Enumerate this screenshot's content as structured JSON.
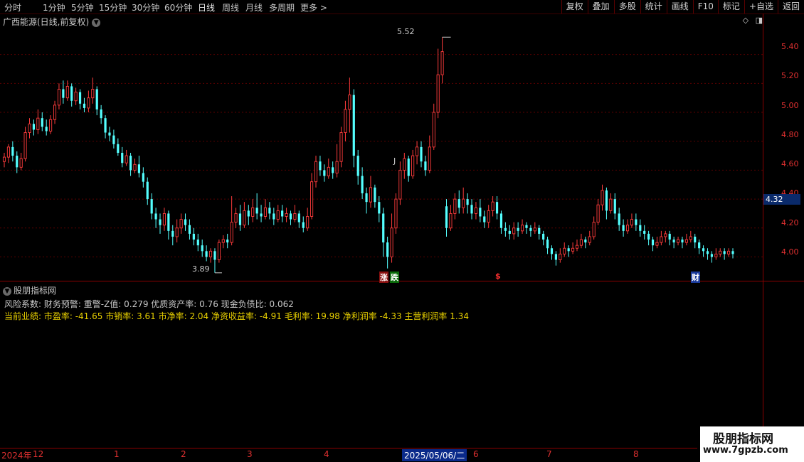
{
  "toolbar": {
    "timeframes": [
      "分时",
      "1分钟",
      "5分钟",
      "15分钟",
      "30分钟",
      "60分钟",
      "日线",
      "周线",
      "月线",
      "多周期",
      "更多 >"
    ],
    "right_buttons": [
      "复权",
      "叠加",
      "多股",
      "统计",
      "画线",
      "F10",
      "标记",
      "+自选",
      "返回"
    ]
  },
  "chart": {
    "title": "广西能源(日线,前复权)",
    "y_ticks": [
      "5.40",
      "5.20",
      "5.00",
      "4.80",
      "4.60",
      "4.40",
      "4.20",
      "4.00"
    ],
    "current_price": "4.32",
    "high_label": "5.52",
    "low_label": "3.89",
    "j_label": "J",
    "markers": {
      "zhang": "涨",
      "die": "跌",
      "dollar": "$",
      "cai": "财"
    }
  },
  "indicator": {
    "title": "股朋指标网",
    "line1": "风险系数: 财务预警: 重警-Z值: 0.279 优质资产率: 0.76 现金负债比: 0.062",
    "line2": "当前业绩: 市盈率: -41.65 市销率: 3.61 市净率: 2.04 净资收益率: -4.91 毛利率: 19.98 净利润率 -4.33 主营利润率 1.34"
  },
  "x_axis": {
    "labels": [
      "2024年",
      "12",
      "1",
      "2",
      "3",
      "4",
      "2025/05/06/二",
      "6",
      "7",
      "8"
    ]
  },
  "watermark": {
    "name": "股朋指标网",
    "url": "www.7gpzb.com"
  },
  "colors": {
    "up": "#ff3c3c",
    "down": "#54ffff",
    "axis": "#8a0000",
    "grid": "#5a0000",
    "info": "#e8d000"
  },
  "chart_data": {
    "type": "candlestick",
    "y_range": [
      3.84,
      5.6
    ],
    "candles": [
      [
        4.66,
        4.69,
        4.62,
        4.72
      ],
      [
        4.69,
        4.76,
        4.65,
        4.78
      ],
      [
        4.76,
        4.7,
        4.66,
        4.8
      ],
      [
        4.7,
        4.62,
        4.58,
        4.73
      ],
      [
        4.62,
        4.68,
        4.6,
        4.72
      ],
      [
        4.68,
        4.86,
        4.66,
        4.9
      ],
      [
        4.86,
        4.92,
        4.82,
        4.96
      ],
      [
        4.92,
        4.88,
        4.84,
        4.95
      ],
      [
        4.88,
        4.96,
        4.85,
        5.02
      ],
      [
        4.96,
        4.9,
        4.87,
        5.0
      ],
      [
        4.9,
        4.87,
        4.84,
        4.95
      ],
      [
        4.87,
        4.95,
        4.85,
        4.98
      ],
      [
        4.95,
        5.05,
        4.92,
        5.08
      ],
      [
        5.05,
        5.16,
        5.02,
        5.2
      ],
      [
        5.16,
        5.1,
        5.06,
        5.22
      ],
      [
        5.1,
        5.18,
        5.08,
        5.22
      ],
      [
        5.18,
        5.08,
        5.04,
        5.2
      ],
      [
        5.08,
        5.14,
        5.05,
        5.17
      ],
      [
        5.14,
        5.06,
        5.02,
        5.16
      ],
      [
        5.06,
        5.03,
        5.0,
        5.1
      ],
      [
        5.03,
        5.1,
        5.0,
        5.15
      ],
      [
        5.1,
        5.16,
        5.06,
        5.24
      ],
      [
        5.16,
        5.02,
        4.98,
        5.18
      ],
      [
        5.02,
        4.96,
        4.92,
        5.05
      ],
      [
        4.96,
        4.86,
        4.82,
        4.98
      ],
      [
        4.86,
        4.84,
        4.8,
        4.9
      ],
      [
        4.84,
        4.78,
        4.75,
        4.88
      ],
      [
        4.78,
        4.72,
        4.7,
        4.82
      ],
      [
        4.72,
        4.65,
        4.62,
        4.76
      ],
      [
        4.65,
        4.7,
        4.63,
        4.74
      ],
      [
        4.7,
        4.6,
        4.56,
        4.72
      ],
      [
        4.6,
        4.64,
        4.58,
        4.68
      ],
      [
        4.64,
        4.58,
        4.55,
        4.7
      ],
      [
        4.58,
        4.52,
        4.48,
        4.62
      ],
      [
        4.52,
        4.4,
        4.36,
        4.55
      ],
      [
        4.4,
        4.3,
        4.26,
        4.44
      ],
      [
        4.3,
        4.26,
        4.2,
        4.34
      ],
      [
        4.26,
        4.22,
        4.16,
        4.3
      ],
      [
        4.22,
        4.3,
        4.18,
        4.34
      ],
      [
        4.3,
        4.18,
        4.12,
        4.32
      ],
      [
        4.18,
        4.14,
        4.08,
        4.22
      ],
      [
        4.14,
        4.2,
        4.1,
        4.26
      ],
      [
        4.2,
        4.26,
        4.16,
        4.3
      ],
      [
        4.26,
        4.22,
        4.18,
        4.3
      ],
      [
        4.22,
        4.16,
        4.12,
        4.26
      ],
      [
        4.16,
        4.12,
        4.08,
        4.2
      ],
      [
        4.12,
        4.08,
        4.04,
        4.16
      ],
      [
        4.08,
        4.04,
        4.0,
        4.12
      ],
      [
        4.04,
        4.0,
        3.97,
        4.08
      ],
      [
        4.0,
        4.04,
        3.96,
        4.06
      ],
      [
        4.04,
        3.98,
        3.89,
        4.06
      ],
      [
        3.98,
        4.1,
        3.96,
        4.12
      ],
      [
        4.1,
        4.12,
        4.06,
        4.15
      ],
      [
        4.12,
        4.1,
        4.06,
        4.16
      ],
      [
        4.1,
        4.24,
        4.08,
        4.42
      ],
      [
        4.24,
        4.3,
        4.2,
        4.34
      ],
      [
        4.3,
        4.22,
        4.18,
        4.36
      ],
      [
        4.22,
        4.32,
        4.2,
        4.38
      ],
      [
        4.32,
        4.28,
        4.22,
        4.36
      ],
      [
        4.28,
        4.34,
        4.24,
        4.4
      ],
      [
        4.34,
        4.3,
        4.26,
        4.44
      ],
      [
        4.3,
        4.28,
        4.24,
        4.36
      ],
      [
        4.28,
        4.34,
        4.26,
        4.4
      ],
      [
        4.34,
        4.3,
        4.26,
        4.38
      ],
      [
        4.3,
        4.26,
        4.22,
        4.34
      ],
      [
        4.26,
        4.32,
        4.24,
        4.36
      ],
      [
        4.32,
        4.28,
        4.24,
        4.36
      ],
      [
        4.28,
        4.3,
        4.24,
        4.34
      ],
      [
        4.3,
        4.26,
        4.22,
        4.32
      ],
      [
        4.26,
        4.3,
        4.24,
        4.36
      ],
      [
        4.3,
        4.24,
        4.2,
        4.32
      ],
      [
        4.24,
        4.2,
        4.17,
        4.28
      ],
      [
        4.2,
        4.28,
        4.18,
        4.34
      ],
      [
        4.28,
        4.52,
        4.26,
        4.58
      ],
      [
        4.52,
        4.66,
        4.48,
        4.7
      ],
      [
        4.66,
        4.6,
        4.56,
        4.7
      ],
      [
        4.6,
        4.56,
        4.52,
        4.64
      ],
      [
        4.56,
        4.62,
        4.54,
        4.68
      ],
      [
        4.62,
        4.58,
        4.54,
        4.66
      ],
      [
        4.58,
        4.66,
        4.55,
        4.78
      ],
      [
        4.66,
        4.86,
        4.62,
        4.9
      ],
      [
        4.86,
        5.02,
        4.8,
        5.08
      ],
      [
        5.02,
        5.12,
        4.86,
        5.24
      ],
      [
        5.12,
        4.7,
        4.62,
        5.16
      ],
      [
        4.7,
        4.56,
        4.5,
        4.74
      ],
      [
        4.56,
        4.44,
        4.4,
        4.62
      ],
      [
        4.44,
        4.38,
        4.3,
        4.48
      ],
      [
        4.38,
        4.48,
        4.34,
        4.56
      ],
      [
        4.48,
        4.38,
        4.34,
        4.5
      ],
      [
        4.38,
        4.3,
        4.24,
        4.42
      ],
      [
        4.3,
        4.1,
        4.0,
        4.34
      ],
      [
        4.1,
        4.0,
        3.92,
        4.14
      ],
      [
        4.0,
        4.2,
        3.96,
        4.3
      ],
      [
        4.2,
        4.4,
        4.16,
        4.44
      ],
      [
        4.4,
        4.6,
        4.36,
        4.66
      ],
      [
        4.6,
        4.68,
        4.54,
        4.72
      ],
      [
        4.68,
        4.56,
        4.52,
        4.7
      ],
      [
        4.56,
        4.7,
        4.54,
        4.74
      ],
      [
        4.7,
        4.76,
        4.64,
        4.8
      ],
      [
        4.76,
        4.66,
        4.62,
        4.8
      ],
      [
        4.66,
        4.6,
        4.56,
        4.7
      ],
      [
        4.6,
        4.76,
        4.58,
        4.84
      ],
      [
        4.76,
        5.0,
        4.74,
        5.06
      ],
      [
        5.0,
        5.26,
        4.96,
        5.44
      ],
      [
        5.26,
        5.42,
        5.2,
        5.52
      ],
      [
        4.35,
        4.2,
        4.14,
        4.4
      ],
      [
        4.2,
        4.3,
        4.18,
        4.36
      ],
      [
        4.3,
        4.4,
        4.26,
        4.44
      ],
      [
        4.4,
        4.34,
        4.3,
        4.46
      ],
      [
        4.34,
        4.4,
        4.3,
        4.48
      ],
      [
        4.4,
        4.36,
        4.3,
        4.44
      ],
      [
        4.36,
        4.3,
        4.26,
        4.4
      ],
      [
        4.3,
        4.34,
        4.26,
        4.38
      ],
      [
        4.34,
        4.28,
        4.24,
        4.4
      ],
      [
        4.28,
        4.24,
        4.2,
        4.32
      ],
      [
        4.24,
        4.32,
        4.2,
        4.36
      ],
      [
        4.32,
        4.38,
        4.28,
        4.42
      ],
      [
        4.38,
        4.3,
        4.26,
        4.42
      ],
      [
        4.3,
        4.2,
        4.16,
        4.32
      ],
      [
        4.2,
        4.18,
        4.14,
        4.24
      ],
      [
        4.18,
        4.16,
        4.12,
        4.22
      ],
      [
        4.16,
        4.2,
        4.12,
        4.24
      ],
      [
        4.2,
        4.18,
        4.14,
        4.24
      ],
      [
        4.18,
        4.22,
        4.16,
        4.26
      ],
      [
        4.22,
        4.2,
        4.16,
        4.24
      ],
      [
        4.2,
        4.18,
        4.14,
        4.22
      ],
      [
        4.18,
        4.2,
        4.16,
        4.24
      ],
      [
        4.2,
        4.16,
        4.12,
        4.22
      ],
      [
        4.16,
        4.12,
        4.08,
        4.18
      ],
      [
        4.12,
        4.06,
        4.02,
        4.14
      ],
      [
        4.06,
        4.02,
        3.98,
        4.08
      ],
      [
        4.02,
        3.98,
        3.94,
        4.04
      ],
      [
        3.98,
        4.02,
        3.96,
        4.06
      ],
      [
        4.02,
        4.06,
        4.0,
        4.1
      ],
      [
        4.06,
        4.04,
        4.0,
        4.08
      ],
      [
        4.04,
        4.06,
        4.02,
        4.1
      ],
      [
        4.06,
        4.08,
        4.04,
        4.12
      ],
      [
        4.08,
        4.12,
        4.06,
        4.16
      ],
      [
        4.12,
        4.1,
        4.06,
        4.14
      ],
      [
        4.1,
        4.14,
        4.08,
        4.18
      ],
      [
        4.14,
        4.24,
        4.12,
        4.28
      ],
      [
        4.24,
        4.36,
        4.22,
        4.4
      ],
      [
        4.36,
        4.46,
        4.32,
        4.5
      ],
      [
        4.46,
        4.32,
        4.26,
        4.48
      ],
      [
        4.32,
        4.4,
        4.3,
        4.44
      ],
      [
        4.4,
        4.3,
        4.26,
        4.44
      ],
      [
        4.3,
        4.22,
        4.18,
        4.34
      ],
      [
        4.22,
        4.18,
        4.14,
        4.26
      ],
      [
        4.18,
        4.22,
        4.16,
        4.26
      ],
      [
        4.22,
        4.26,
        4.2,
        4.3
      ],
      [
        4.26,
        4.22,
        4.18,
        4.3
      ],
      [
        4.22,
        4.18,
        4.14,
        4.26
      ],
      [
        4.18,
        4.16,
        4.12,
        4.22
      ],
      [
        4.16,
        4.12,
        4.08,
        4.18
      ],
      [
        4.12,
        4.08,
        4.04,
        4.14
      ],
      [
        4.08,
        4.1,
        4.06,
        4.14
      ],
      [
        4.1,
        4.14,
        4.08,
        4.18
      ],
      [
        4.14,
        4.16,
        4.1,
        4.18
      ],
      [
        4.16,
        4.12,
        4.08,
        4.18
      ],
      [
        4.12,
        4.1,
        4.06,
        4.14
      ],
      [
        4.1,
        4.12,
        4.08,
        4.14
      ],
      [
        4.12,
        4.1,
        4.06,
        4.14
      ],
      [
        4.1,
        4.12,
        4.08,
        4.16
      ],
      [
        4.12,
        4.14,
        4.1,
        4.18
      ],
      [
        4.14,
        4.1,
        4.06,
        4.16
      ],
      [
        4.1,
        4.06,
        4.02,
        4.12
      ],
      [
        4.06,
        4.04,
        4.0,
        4.08
      ],
      [
        4.04,
        4.02,
        3.98,
        4.06
      ],
      [
        4.02,
        4.0,
        3.96,
        4.04
      ],
      [
        4.0,
        4.02,
        3.98,
        4.06
      ],
      [
        4.02,
        4.04,
        4.0,
        4.06
      ],
      [
        4.04,
        4.02,
        3.98,
        4.06
      ],
      [
        4.02,
        4.04,
        4.0,
        4.06
      ],
      [
        4.04,
        4.02,
        3.99,
        4.06
      ]
    ]
  }
}
